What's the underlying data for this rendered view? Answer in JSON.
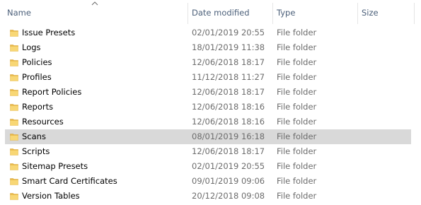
{
  "columns": {
    "name": "Name",
    "date_modified": "Date modified",
    "type": "Type",
    "size": "Size"
  },
  "sort": {
    "column": "Name",
    "direction": "ascending",
    "icon": "sort-up-chevron"
  },
  "colors": {
    "header_text": "#4c607a",
    "secondary_text": "#6d6d6d",
    "selected_row": "#d9d9d9",
    "folder_yellow": "#f8d775"
  },
  "items": [
    {
      "name": "Issue Presets",
      "date": "02/01/2019 20:55",
      "type": "File folder",
      "size": "",
      "selected": false,
      "icon": "folder-icon"
    },
    {
      "name": "Logs",
      "date": "18/01/2019 11:38",
      "type": "File folder",
      "size": "",
      "selected": false,
      "icon": "folder-icon"
    },
    {
      "name": "Policies",
      "date": "12/06/2018 18:17",
      "type": "File folder",
      "size": "",
      "selected": false,
      "icon": "folder-icon"
    },
    {
      "name": "Profiles",
      "date": "11/12/2018 11:27",
      "type": "File folder",
      "size": "",
      "selected": false,
      "icon": "folder-icon"
    },
    {
      "name": "Report Policies",
      "date": "12/06/2018 18:17",
      "type": "File folder",
      "size": "",
      "selected": false,
      "icon": "folder-icon"
    },
    {
      "name": "Reports",
      "date": "12/06/2018 18:16",
      "type": "File folder",
      "size": "",
      "selected": false,
      "icon": "folder-icon"
    },
    {
      "name": "Resources",
      "date": "12/06/2018 18:16",
      "type": "File folder",
      "size": "",
      "selected": false,
      "icon": "folder-icon"
    },
    {
      "name": "Scans",
      "date": "08/01/2019 16:18",
      "type": "File folder",
      "size": "",
      "selected": true,
      "icon": "folder-icon"
    },
    {
      "name": "Scripts",
      "date": "12/06/2018 18:17",
      "type": "File folder",
      "size": "",
      "selected": false,
      "icon": "folder-icon"
    },
    {
      "name": "Sitemap Presets",
      "date": "02/01/2019 20:55",
      "type": "File folder",
      "size": "",
      "selected": false,
      "icon": "folder-icon"
    },
    {
      "name": "Smart Card Certificates",
      "date": "09/01/2019 09:06",
      "type": "File folder",
      "size": "",
      "selected": false,
      "icon": "folder-icon"
    },
    {
      "name": "Version Tables",
      "date": "20/12/2018 09:08",
      "type": "File folder",
      "size": "",
      "selected": false,
      "icon": "folder-icon"
    }
  ]
}
